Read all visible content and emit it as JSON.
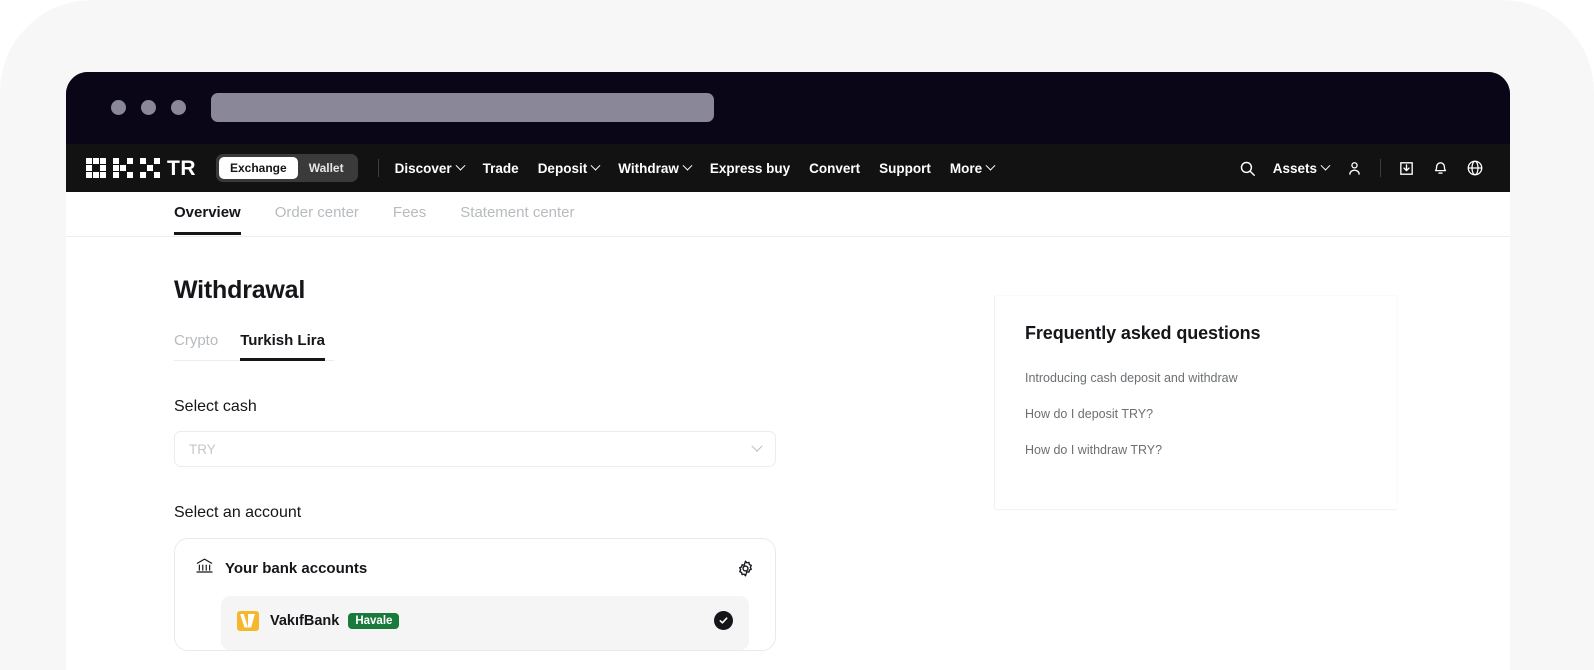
{
  "browser": {
    "traffic_lights": [
      "dot-1",
      "dot-2",
      "dot-3"
    ],
    "url_value": ""
  },
  "header": {
    "brand": "TR",
    "brand_logo_icon": "okx-pixel-logo-icon",
    "mode_toggle": {
      "options": [
        "Exchange",
        "Wallet"
      ],
      "selected": "Exchange"
    },
    "nav": [
      {
        "label": "Discover",
        "has_caret": true
      },
      {
        "label": "Trade",
        "has_caret": false
      },
      {
        "label": "Deposit",
        "has_caret": true
      },
      {
        "label": "Withdraw",
        "has_caret": true
      },
      {
        "label": "Express buy",
        "has_caret": false
      },
      {
        "label": "Convert",
        "has_caret": false
      },
      {
        "label": "Support",
        "has_caret": false
      },
      {
        "label": "More",
        "has_caret": true
      }
    ],
    "right": {
      "search_icon": "search-icon",
      "assets_label": "Assets",
      "profile_icon": "user-icon",
      "download_icon": "download-app-icon",
      "notification_icon": "bell-icon",
      "language_icon": "globe-icon"
    }
  },
  "sub_nav": {
    "items": [
      {
        "label": "Overview",
        "active": true
      },
      {
        "label": "Order center",
        "active": false
      },
      {
        "label": "Fees",
        "active": false
      },
      {
        "label": "Statement center",
        "active": false
      }
    ]
  },
  "main": {
    "title": "Withdrawal",
    "asset_tabs": [
      {
        "label": "Crypto",
        "active": false
      },
      {
        "label": "Turkish Lira",
        "active": true
      }
    ],
    "select_cash": {
      "label": "Select cash",
      "value": "TRY",
      "placeholder": "TRY",
      "chevron_icon": "chevron-down-icon"
    },
    "select_account": {
      "label": "Select an account",
      "card_icon": "bank-building-icon",
      "card_title": "Your bank accounts",
      "settings_icon": "gear-icon",
      "accounts": [
        {
          "logo_icon": "vakifbank-logo-icon",
          "name": "VakıfBank",
          "badge": "Havale",
          "selected": true,
          "check_icon": "check-circle-icon"
        }
      ]
    }
  },
  "faq": {
    "title": "Frequently asked questions",
    "links": [
      "Introducing cash deposit and withdraw",
      "How do I deposit TRY?",
      "How do I withdraw TRY?"
    ]
  },
  "colors": {
    "chrome_bg": "#0a0618",
    "header_bg": "#121212",
    "page_bg": "#ffffff",
    "panel_bg": "#f7f7f8",
    "accent_text": "#16161a",
    "muted_text": "#b7bbbe",
    "badge_green": "#1a7a3c",
    "bank_yellow": "#f5b72b"
  }
}
